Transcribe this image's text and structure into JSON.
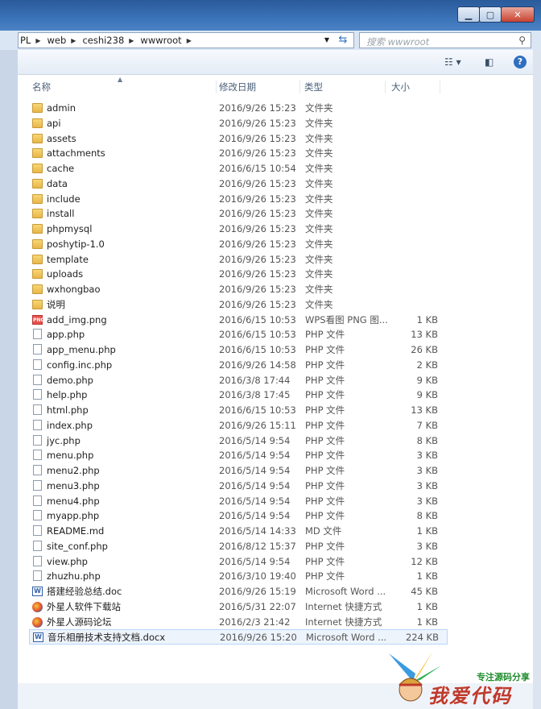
{
  "window": {
    "controls": [
      "minimize",
      "maximize",
      "close"
    ]
  },
  "address": {
    "crumbs": [
      "PL",
      "web",
      "ceshi238",
      "wwwroot"
    ]
  },
  "search": {
    "placeholder": "搜索 wwwroot"
  },
  "columns": {
    "name": "名称",
    "date": "修改日期",
    "type": "类型",
    "size": "大小"
  },
  "files": [
    {
      "name": "admin",
      "date": "2016/9/26 15:23",
      "type": "文件夹",
      "size": "",
      "icon": "folder-icon"
    },
    {
      "name": "api",
      "date": "2016/9/26 15:23",
      "type": "文件夹",
      "size": "",
      "icon": "folder-icon"
    },
    {
      "name": "assets",
      "date": "2016/9/26 15:23",
      "type": "文件夹",
      "size": "",
      "icon": "folder-icon"
    },
    {
      "name": "attachments",
      "date": "2016/9/26 15:23",
      "type": "文件夹",
      "size": "",
      "icon": "folder-icon"
    },
    {
      "name": "cache",
      "date": "2016/6/15 10:54",
      "type": "文件夹",
      "size": "",
      "icon": "folder-icon"
    },
    {
      "name": "data",
      "date": "2016/9/26 15:23",
      "type": "文件夹",
      "size": "",
      "icon": "folder-icon"
    },
    {
      "name": "include",
      "date": "2016/9/26 15:23",
      "type": "文件夹",
      "size": "",
      "icon": "folder-icon"
    },
    {
      "name": "install",
      "date": "2016/9/26 15:23",
      "type": "文件夹",
      "size": "",
      "icon": "folder-icon"
    },
    {
      "name": "phpmysql",
      "date": "2016/9/26 15:23",
      "type": "文件夹",
      "size": "",
      "icon": "folder-icon"
    },
    {
      "name": "poshytip-1.0",
      "date": "2016/9/26 15:23",
      "type": "文件夹",
      "size": "",
      "icon": "folder-icon"
    },
    {
      "name": "template",
      "date": "2016/9/26 15:23",
      "type": "文件夹",
      "size": "",
      "icon": "folder-icon"
    },
    {
      "name": "uploads",
      "date": "2016/9/26 15:23",
      "type": "文件夹",
      "size": "",
      "icon": "folder-icon"
    },
    {
      "name": "wxhongbao",
      "date": "2016/9/26 15:23",
      "type": "文件夹",
      "size": "",
      "icon": "folder-icon"
    },
    {
      "name": "说明",
      "date": "2016/9/26 15:23",
      "type": "文件夹",
      "size": "",
      "icon": "folder-icon"
    },
    {
      "name": "add_img.png",
      "date": "2016/6/15 10:53",
      "type": "WPS看图 PNG 图...",
      "size": "1 KB",
      "icon": "png-icon"
    },
    {
      "name": "app.php",
      "date": "2016/6/15 10:53",
      "type": "PHP 文件",
      "size": "13 KB",
      "icon": "file-icon"
    },
    {
      "name": "app_menu.php",
      "date": "2016/6/15 10:53",
      "type": "PHP 文件",
      "size": "26 KB",
      "icon": "file-icon"
    },
    {
      "name": "config.inc.php",
      "date": "2016/9/26 14:58",
      "type": "PHP 文件",
      "size": "2 KB",
      "icon": "file-icon"
    },
    {
      "name": "demo.php",
      "date": "2016/3/8 17:44",
      "type": "PHP 文件",
      "size": "9 KB",
      "icon": "file-icon"
    },
    {
      "name": "help.php",
      "date": "2016/3/8 17:45",
      "type": "PHP 文件",
      "size": "9 KB",
      "icon": "file-icon"
    },
    {
      "name": "html.php",
      "date": "2016/6/15 10:53",
      "type": "PHP 文件",
      "size": "13 KB",
      "icon": "file-icon"
    },
    {
      "name": "index.php",
      "date": "2016/9/26 15:11",
      "type": "PHP 文件",
      "size": "7 KB",
      "icon": "file-icon"
    },
    {
      "name": "jyc.php",
      "date": "2016/5/14 9:54",
      "type": "PHP 文件",
      "size": "8 KB",
      "icon": "file-icon"
    },
    {
      "name": "menu.php",
      "date": "2016/5/14 9:54",
      "type": "PHP 文件",
      "size": "3 KB",
      "icon": "file-icon"
    },
    {
      "name": "menu2.php",
      "date": "2016/5/14 9:54",
      "type": "PHP 文件",
      "size": "3 KB",
      "icon": "file-icon"
    },
    {
      "name": "menu3.php",
      "date": "2016/5/14 9:54",
      "type": "PHP 文件",
      "size": "3 KB",
      "icon": "file-icon"
    },
    {
      "name": "menu4.php",
      "date": "2016/5/14 9:54",
      "type": "PHP 文件",
      "size": "3 KB",
      "icon": "file-icon"
    },
    {
      "name": "myapp.php",
      "date": "2016/5/14 9:54",
      "type": "PHP 文件",
      "size": "8 KB",
      "icon": "file-icon"
    },
    {
      "name": "README.md",
      "date": "2016/5/14 14:33",
      "type": "MD 文件",
      "size": "1 KB",
      "icon": "file-icon"
    },
    {
      "name": "site_conf.php",
      "date": "2016/8/12 15:37",
      "type": "PHP 文件",
      "size": "3 KB",
      "icon": "file-icon"
    },
    {
      "name": "view.php",
      "date": "2016/5/14 9:54",
      "type": "PHP 文件",
      "size": "12 KB",
      "icon": "file-icon"
    },
    {
      "name": "zhuzhu.php",
      "date": "2016/3/10 19:40",
      "type": "PHP 文件",
      "size": "1 KB",
      "icon": "file-icon"
    },
    {
      "name": "搭建经验总结.doc",
      "date": "2016/9/26 15:19",
      "type": "Microsoft Word ...",
      "size": "45 KB",
      "icon": "word-icon"
    },
    {
      "name": "外星人软件下载站",
      "date": "2016/5/31 22:07",
      "type": "Internet 快捷方式",
      "size": "1 KB",
      "icon": "ie-icon"
    },
    {
      "name": "外星人源码论坛",
      "date": "2016/2/3 21:42",
      "type": "Internet 快捷方式",
      "size": "1 KB",
      "icon": "ie-icon"
    },
    {
      "name": "音乐相册技术支持文档.docx",
      "date": "2016/9/26 15:20",
      "type": "Microsoft Word ...",
      "size": "224 KB",
      "icon": "word-icon",
      "selected": true
    }
  ],
  "watermark": {
    "tagline": "专注源码分享",
    "title": "我爱代码"
  },
  "colors": {
    "titlebar": "#3b73b8",
    "folder": "#f0c75e",
    "selection": "#cce4fc"
  }
}
